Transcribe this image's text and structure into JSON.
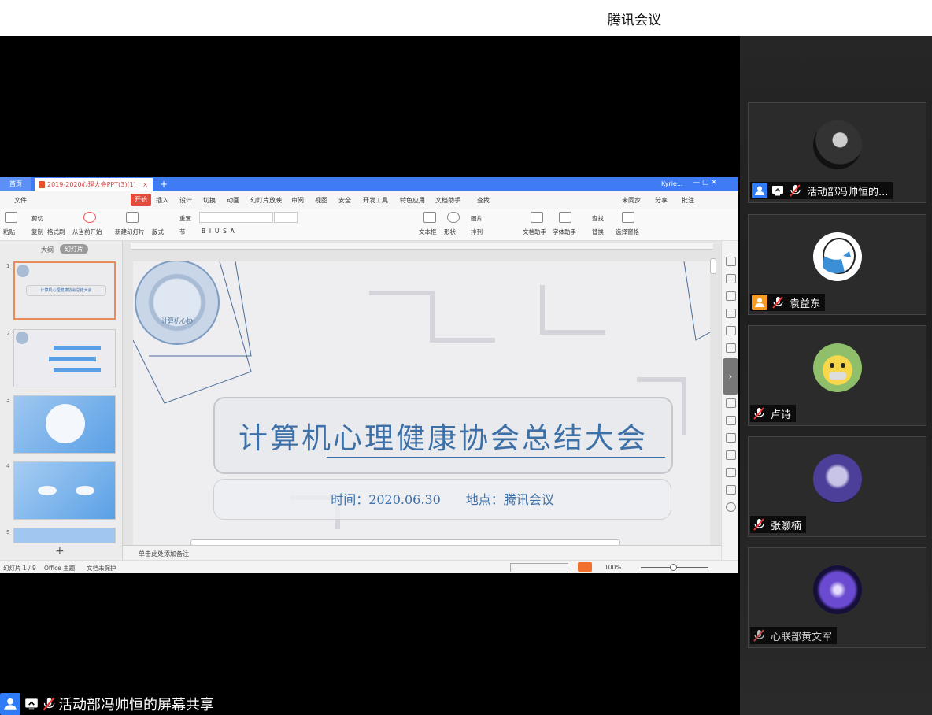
{
  "window": {
    "title": "腾讯会议"
  },
  "wps": {
    "tabs": {
      "home": "首页",
      "doc": "2019-2020心理大会PPT(3)(1)",
      "close": "×",
      "new": "+"
    },
    "user": "Kyrie...",
    "menu": [
      "文件",
      "开始",
      "插入",
      "设计",
      "切换",
      "动画",
      "幻灯片放映",
      "审阅",
      "视图",
      "安全",
      "开发工具",
      "特色应用",
      "文档助手",
      "查找"
    ],
    "menu_right": [
      "未同步",
      "分享",
      "批注"
    ],
    "toolbar": [
      "粘贴",
      "剪切",
      "复制",
      "格式刷",
      "从当前开始",
      "新建幻灯片",
      "版式",
      "节",
      "重置",
      "文本框",
      "形状",
      "排列",
      "图片",
      "文档助手",
      "字体助手",
      "查找",
      "替换",
      "选择窗格"
    ],
    "panel_tabs": {
      "outline": "大纲",
      "slides": "幻灯片"
    },
    "thumb_numbers": [
      "1",
      "2",
      "3",
      "4",
      "5"
    ],
    "thumb_add": "+",
    "notes": "单击此处添加备注",
    "status": {
      "slide": "幻灯片 1 / 9",
      "theme": "Office 主题",
      "protect": "文档未保护",
      "zoom": "100%"
    },
    "slide": {
      "logo_text": "计算机心协",
      "title": "计算机心理健康协会总结大会",
      "info": "时间：2020.06.30　　地点：腾讯会议"
    }
  },
  "participants": [
    {
      "name": "活动部冯帅恒的...",
      "badge": "blue"
    },
    {
      "name": "袁益东",
      "badge": "orange"
    },
    {
      "name": "卢诗",
      "badge": "none"
    },
    {
      "name": "张灏楠",
      "badge": "none"
    },
    {
      "name": "心联部黄文军",
      "badge": "none"
    }
  ],
  "footer": {
    "share_label": "活动部冯帅恒的屏幕共享"
  },
  "colors": {
    "wps_blue": "#3e7bf5",
    "start_red": "#e54b3c",
    "slide_text": "#3e70a8",
    "badge_blue": "#2f7cf6",
    "badge_orange": "#f59a23"
  }
}
